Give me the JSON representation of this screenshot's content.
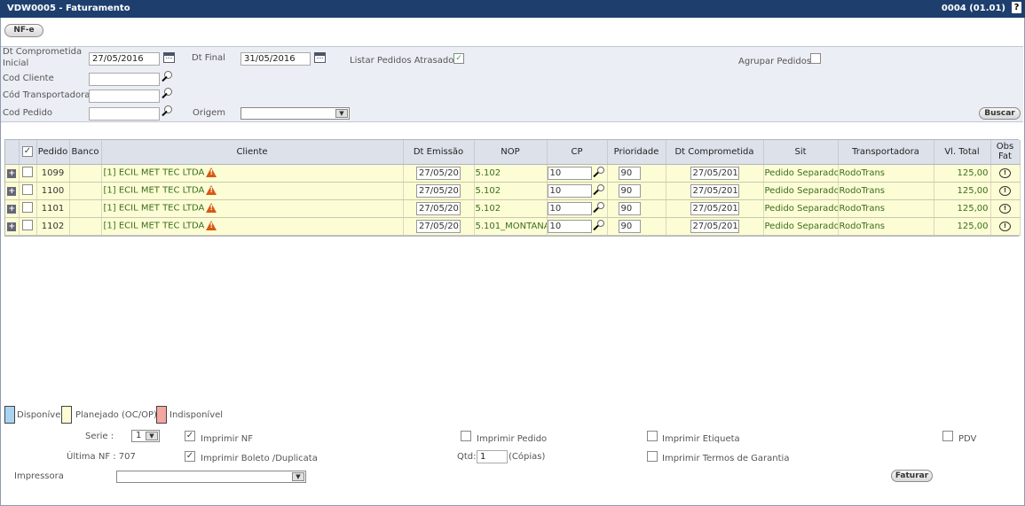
{
  "window": {
    "title": "VDW0005 - Faturamento",
    "version": "0004 (01.01)",
    "help": "?"
  },
  "toolbar": {
    "nfe_label": "NF-e"
  },
  "filters": {
    "dt_comprometida_inicial_label_1": "Dt Comprometida",
    "dt_comprometida_inicial_label_2": "Inicial",
    "dt_comprometida_inicial_value": "27/05/2016",
    "dt_final_label": "Dt Final",
    "dt_final_value": "31/05/2016",
    "listar_atrasados_label": "Listar Pedidos Atrasados",
    "listar_atrasados_checked": true,
    "agrupar_pedidos_label": "Agrupar Pedidos",
    "agrupar_pedidos_checked": false,
    "cod_cliente_label": "Cod Cliente",
    "cod_transportadora_label": "Cód Transportadora",
    "cod_pedido_label": "Cod Pedido",
    "origem_label": "Origem",
    "origem_value": "",
    "buscar_label": "Buscar"
  },
  "grid": {
    "headers": {
      "pedido": "Pedido",
      "banco": "Banco",
      "cliente": "Cliente",
      "dt_emissao": "Dt Emissão",
      "nop": "NOP",
      "cp": "CP",
      "prioridade": "Prioridade",
      "dt_comprometida": "Dt Comprometida",
      "sit": "Sit",
      "transportadora": "Transportadora",
      "vl_total": "Vl. Total",
      "obs_fat_1": "Obs",
      "obs_fat_2": "Fat"
    },
    "rows": [
      {
        "pedido": "1099",
        "banco": "",
        "cliente": "[1] ECIL MET TEC LTDA",
        "dt_emissao": "27/05/201",
        "nop": "5.102",
        "cp": "10",
        "prioridade": "90",
        "dt_comprometida": "27/05/2016",
        "sit": "Pedido Separado",
        "transportadora": "RodoTrans",
        "vl_total": "125,00"
      },
      {
        "pedido": "1100",
        "banco": "",
        "cliente": "[1] ECIL MET TEC LTDA",
        "dt_emissao": "27/05/201",
        "nop": "5.102",
        "cp": "10",
        "prioridade": "90",
        "dt_comprometida": "27/05/2016",
        "sit": "Pedido Separado",
        "transportadora": "RodoTrans",
        "vl_total": "125,00"
      },
      {
        "pedido": "1101",
        "banco": "",
        "cliente": "[1] ECIL MET TEC LTDA",
        "dt_emissao": "27/05/201",
        "nop": "5.102",
        "cp": "10",
        "prioridade": "90",
        "dt_comprometida": "27/05/2016",
        "sit": "Pedido Separado",
        "transportadora": "RodoTrans",
        "vl_total": "125,00"
      },
      {
        "pedido": "1102",
        "banco": "",
        "cliente": "[1] ECIL MET TEC LTDA",
        "dt_emissao": "27/05/201",
        "nop": "5.101_MONTANA",
        "cp": "10",
        "prioridade": "90",
        "dt_comprometida": "27/05/2016",
        "sit": "Pedido Separado",
        "transportadora": "RodoTrans",
        "vl_total": "125,00"
      }
    ]
  },
  "legend": {
    "disponivel": "Disponível",
    "planejado": "Planejado (OC/OP)",
    "indisponivel": "Indisponível",
    "colors": {
      "disponivel": "#a9d3f2",
      "planejado": "#fdfdd5",
      "indisponivel": "#f4a6a1"
    }
  },
  "footer": {
    "serie_label": "Serie :",
    "serie_value": "1",
    "ultima_nf": "Última NF : 707",
    "imprimir_nf": "Imprimir NF",
    "imprimir_nf_checked": true,
    "imprimir_boleto": "Imprimir Boleto /Duplicata",
    "imprimir_boleto_checked": true,
    "imprimir_pedido": "Imprimir Pedido",
    "imprimir_pedido_checked": false,
    "qtd_label": "Qtd:",
    "qtd_value": "1",
    "copias_label": "(Cópias)",
    "imprimir_etiqueta": "Imprimir Etiqueta",
    "imprimir_etiqueta_checked": false,
    "imprimir_termos": "Imprimir Termos de Garantia",
    "imprimir_termos_checked": false,
    "pdv": "PDV",
    "pdv_checked": false,
    "impressora_label": "Impressora",
    "impressora_value": "",
    "faturar_label": "Faturar"
  },
  "icons": {
    "calendar": "calendar-icon",
    "lookup": "lookup-lens-icon",
    "expand": "expand-plus-icon",
    "warning": "warning-triangle-icon",
    "observation": "observation-bubble-icon",
    "dropdown": "chevron-down-icon"
  }
}
